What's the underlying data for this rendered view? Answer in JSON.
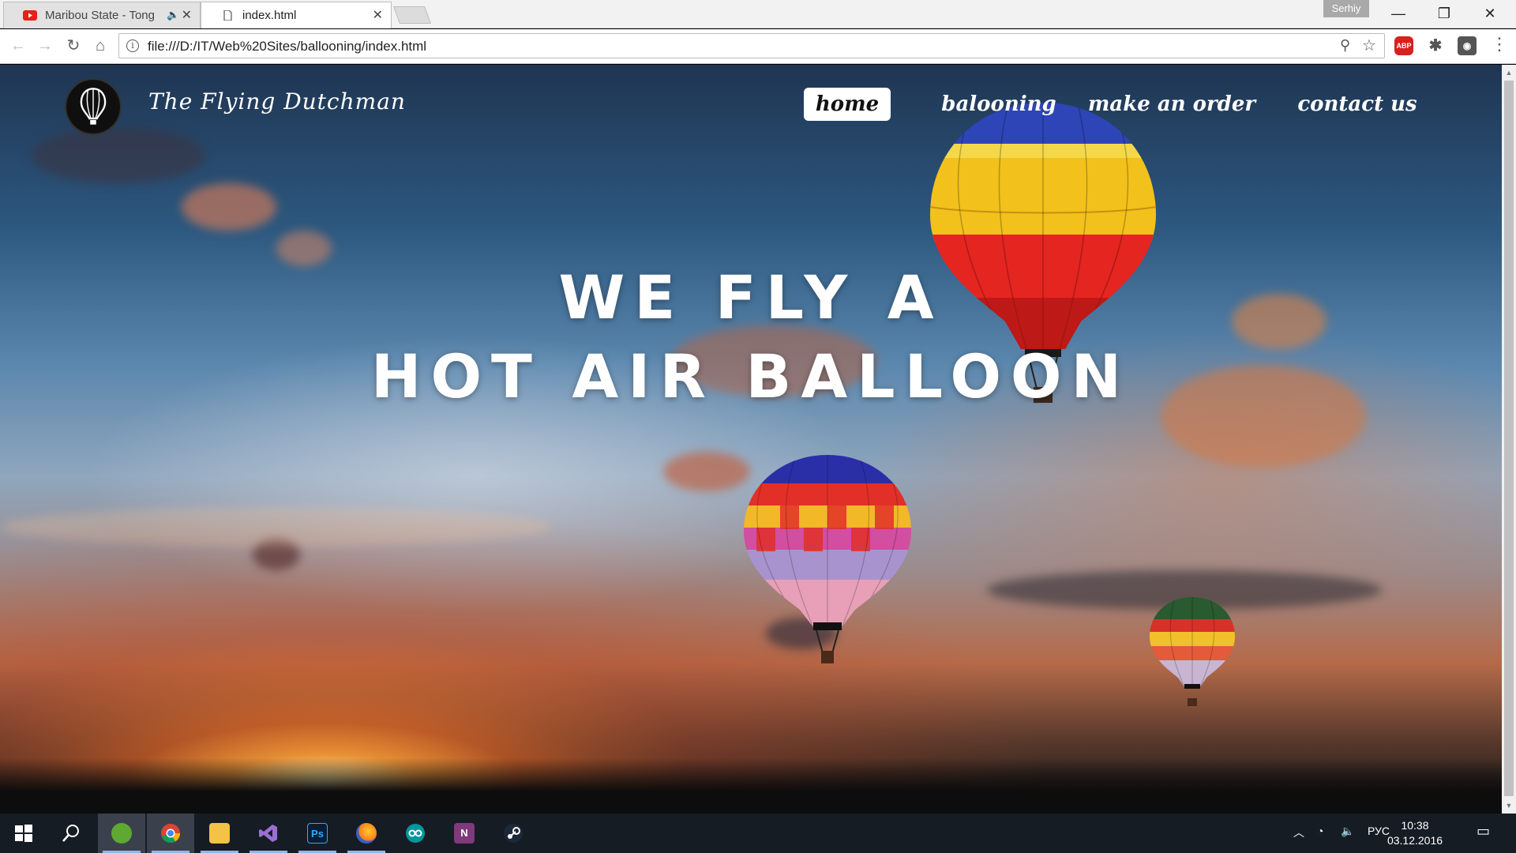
{
  "browser": {
    "tabs": [
      {
        "title": "Maribou State - Tong",
        "audio_icon": "speaker-muted-icon",
        "favicon": "youtube-icon"
      },
      {
        "title": "index.html",
        "favicon": "file-icon"
      }
    ],
    "profile_name": "Serhiy",
    "url": "file:///D:/IT/Web%20Sites/ballooning/index.html",
    "close_glyph": "✕",
    "extensions": {
      "abp_label": "ABP"
    }
  },
  "site": {
    "brand": "The Flying Dutchman",
    "nav": {
      "home": "home",
      "ballooning": "balooning",
      "order": "make an order",
      "contact": "contact us"
    },
    "hero": {
      "line1": "WE FLY A",
      "line2": "HOT AIR BALLOON"
    }
  },
  "taskbar": {
    "apps": [
      "start-icon",
      "search-icon",
      "greenshot-icon",
      "chrome-icon",
      "explorer-icon",
      "visual-studio-icon",
      "photoshop-icon",
      "firefox-icon",
      "arduino-icon",
      "onenote-icon",
      "steam-icon"
    ],
    "photoshop_label": "Ps",
    "onenote_label": "N",
    "language": "РУС",
    "time": "10:38",
    "date": "03.12.2016"
  },
  "colors": {
    "nav_active_bg": "#ffffff",
    "taskbar_bg": "#161c24",
    "abp_red": "#d8201d"
  }
}
